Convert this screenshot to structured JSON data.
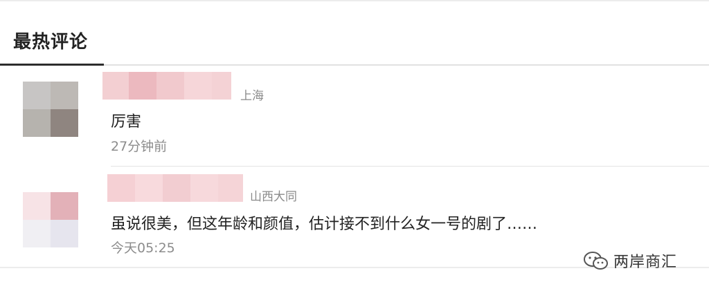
{
  "section": {
    "title": "最热评论"
  },
  "comments": [
    {
      "location": "上海",
      "content": "厉害",
      "time": "27分钟前"
    },
    {
      "location": "山西大同",
      "content": "虽说很美，但这年龄和颜值，估计接不到什么女一号的剧了……",
      "time": "今天05:25"
    }
  ],
  "watermark": {
    "icon": "wechat-icon",
    "text": "两岸商汇"
  }
}
